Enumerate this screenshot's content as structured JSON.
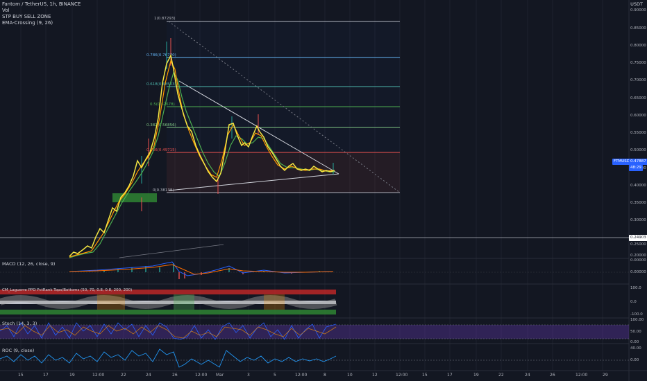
{
  "header": {
    "symbol": "Fantom / TetherUS, 1h, BINANCE",
    "vol": "Vol",
    "stp": "STP BUY SELL ZONE",
    "ema": "EMA-Crossing (9, 26)"
  },
  "currency": "USDT",
  "price_axis": [
    "0.90000",
    "0.85000",
    "0.80000",
    "0.75000",
    "0.70000",
    "0.65000",
    "0.60000",
    "0.55000",
    "0.50000",
    "0.45000",
    "0.40000",
    "0.35000",
    "0.30000",
    "0.25000",
    "0.20000"
  ],
  "price_tags": {
    "current_label": "FTMUSDT",
    "current_value": "0.47887",
    "countdown": "48:29",
    "line_value": "0.24903"
  },
  "fib_labels": [
    "1(0.87293)",
    "0.786(0.76770)",
    "0.618(0.68503)",
    "0.5(0.62678)",
    "0.382(0.56856)",
    "0.236(0.49715)",
    "0(0.38138)"
  ],
  "indicators": {
    "macd": "MACD (12, 26, close, 9)",
    "macd_axis": [
      "0.00000",
      "0.00000"
    ],
    "cm": "CM_Laguerre PPO PctRank Tops/Bottoms (50, 70, 0.8, 0.8, 200, 200)",
    "cm_axis": [
      "100.0",
      "0.0",
      "-100.0"
    ],
    "stoch": "Stoch (14, 3, 3)",
    "stoch_axis": [
      "100.00",
      "50.00",
      "0.00"
    ],
    "roc": "ROC (9, close)",
    "roc_axis": [
      "40.00",
      "0.00"
    ]
  },
  "time_axis": [
    "15",
    "17",
    "19",
    "12:00",
    "22",
    "24",
    "26",
    "12:00",
    "Mar",
    "3",
    "5",
    "12:00",
    "8",
    "10",
    "12",
    "12:00",
    "15",
    "17",
    "19",
    "22",
    "24",
    "26",
    "12:00",
    "29"
  ],
  "colors": {
    "background": "#131722",
    "price_line": "#f5e642",
    "ema_fast": "#ff9800",
    "ema_slow": "#4caf50",
    "fib_top": "#b2b5be",
    "fib_786": "#64b5f6",
    "fib_618": "#4db6ac",
    "fib_5": "#4caf50",
    "fib_382": "#81c784",
    "fib_236": "#ef5350",
    "buy_zone": "#2e7d32",
    "stoch_band": "#673ab7"
  }
}
